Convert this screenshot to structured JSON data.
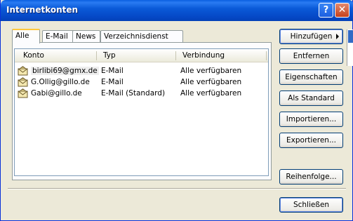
{
  "window": {
    "title": "Internetkonten"
  },
  "titlebar": {
    "help_label": "?",
    "close_label": "✕"
  },
  "tabs": [
    {
      "label": "Alle"
    },
    {
      "label": "E-Mail"
    },
    {
      "label": "News"
    },
    {
      "label": "Verzeichnisdienst"
    }
  ],
  "list": {
    "columns": [
      "Konto",
      "Typ",
      "Verbindung"
    ],
    "rows": [
      {
        "konto": "birlibi69@gmx.de",
        "typ": "E-Mail",
        "verbindung": "Alle verfügbaren"
      },
      {
        "konto": "G.Ollig@gillo.de",
        "typ": "E-Mail",
        "verbindung": "Alle verfügbaren"
      },
      {
        "konto": "Gabi@gillo.de",
        "typ": "E-Mail (Standard)",
        "verbindung": "Alle verfügbaren"
      }
    ]
  },
  "buttons": {
    "add": "Hinzufügen",
    "remove": "Entfernen",
    "properties": "Eigenschaften",
    "set_default": "Als Standard",
    "import": "Importieren...",
    "export": "Exportieren...",
    "order": "Reihenfolge...",
    "close": "Schließen"
  },
  "icons": {
    "account": "mail-account-icon",
    "submenu_arrow": "arrow-right-icon"
  },
  "colors": {
    "titlebar": "#0a5ad8",
    "window_bg": "#ece9d8",
    "tab_highlight": "#ffc83c",
    "selection": "#316ac5"
  }
}
